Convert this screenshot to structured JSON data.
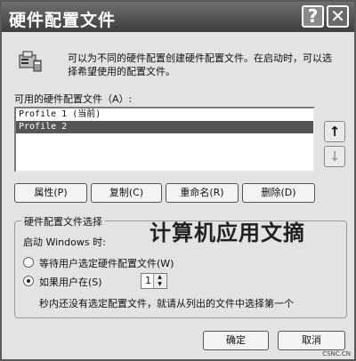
{
  "window": {
    "title": "硬件配置文件",
    "help_glyph": "?",
    "close_glyph": "✕"
  },
  "info": {
    "text": "可以为不同的硬件配置创建硬件配置文件。在启动时，可以选择希望使用的配置文件。"
  },
  "profiles": {
    "label": "可用的硬件配置文件（A）:",
    "items": [
      {
        "label": "Profile 1 (当前)",
        "selected": false
      },
      {
        "label": "Profile 2",
        "selected": true
      }
    ],
    "move_up_glyph": "↑",
    "move_down_glyph": "↓"
  },
  "actions": {
    "properties": "属性(P)",
    "copy": "复制(C)",
    "rename": "重命名(R)",
    "delete": "删除(D)"
  },
  "selection": {
    "group_title": "硬件配置文件选择",
    "startup_label": "启动 Windows 时:",
    "option_wait": "等待用户选定硬件配置文件(W)",
    "option_auto": "如果用户在(S)",
    "seconds_value": "1",
    "auto_suffix": "秒内还没有选定配置文件，就请从列出的文件中选择第一个"
  },
  "watermark": "计算机应用文摘",
  "dialog": {
    "ok": "确定",
    "cancel": "取消"
  },
  "footer": "CSNC.CN"
}
